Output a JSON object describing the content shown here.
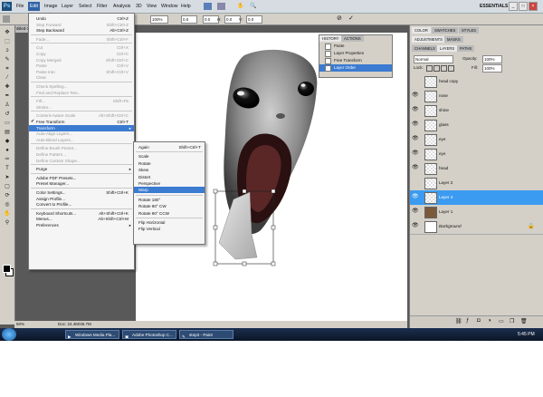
{
  "menubar": {
    "items": [
      "File",
      "Edit",
      "Image",
      "Layer",
      "Select",
      "Filter",
      "Analysis",
      "3D",
      "View",
      "Window",
      "Help"
    ],
    "active": "Edit",
    "workspace": "ESSENTIALS"
  },
  "options": {
    "zoom": "100%",
    "w": "0.0",
    "h": "0.0",
    "hlabel": "H:",
    "vlabel": "V:",
    "h_deg": "0.0"
  },
  "document": {
    "tab": "Untitled-1",
    "zoom": "50%",
    "info": "Doc: 24.4M/46.7M"
  },
  "edit_menu": [
    {
      "label": "Undo",
      "shortcut": "Ctrl+Z",
      "dis": false
    },
    {
      "label": "Step Forward",
      "shortcut": "Shift+Ctrl+Z",
      "dis": true
    },
    {
      "label": "Step Backward",
      "shortcut": "Alt+Ctrl+Z",
      "dis": false
    },
    {
      "sep": true
    },
    {
      "label": "Fade...",
      "shortcut": "Shift+Ctrl+F",
      "dis": true
    },
    {
      "sep": true
    },
    {
      "label": "Cut",
      "shortcut": "Ctrl+X",
      "dis": true
    },
    {
      "label": "Copy",
      "shortcut": "Ctrl+C",
      "dis": true
    },
    {
      "label": "Copy Merged",
      "shortcut": "Shift+Ctrl+C",
      "dis": true
    },
    {
      "label": "Paste",
      "shortcut": "Ctrl+V",
      "dis": true
    },
    {
      "label": "Paste Into",
      "shortcut": "Shift+Ctrl+V",
      "dis": true
    },
    {
      "label": "Clear",
      "shortcut": "",
      "dis": true
    },
    {
      "sep": true
    },
    {
      "label": "Check Spelling...",
      "shortcut": "",
      "dis": true
    },
    {
      "label": "Find and Replace Text...",
      "shortcut": "",
      "dis": true
    },
    {
      "sep": true
    },
    {
      "label": "Fill...",
      "shortcut": "Shift+F5",
      "dis": true
    },
    {
      "label": "Stroke...",
      "shortcut": "",
      "dis": true
    },
    {
      "sep": true
    },
    {
      "label": "Content-Aware Scale",
      "shortcut": "Alt+Shift+Ctrl+C",
      "dis": true
    },
    {
      "label": "Free Transform",
      "shortcut": "Ctrl+T",
      "dis": false,
      "check": true
    },
    {
      "label": "Transform",
      "shortcut": "",
      "dis": false,
      "hl": true,
      "sub": true
    },
    {
      "label": "Auto-Align Layers...",
      "shortcut": "",
      "dis": true
    },
    {
      "label": "Auto-Blend Layers...",
      "shortcut": "",
      "dis": true
    },
    {
      "sep": true
    },
    {
      "label": "Define Brush Preset...",
      "shortcut": "",
      "dis": true
    },
    {
      "label": "Define Pattern...",
      "shortcut": "",
      "dis": true
    },
    {
      "label": "Define Custom Shape...",
      "shortcut": "",
      "dis": true
    },
    {
      "sep": true
    },
    {
      "label": "Purge",
      "shortcut": "",
      "dis": false,
      "sub": true
    },
    {
      "sep": true
    },
    {
      "label": "Adobe PDF Presets...",
      "shortcut": "",
      "dis": false
    },
    {
      "label": "Preset Manager...",
      "shortcut": "",
      "dis": false
    },
    {
      "sep": true
    },
    {
      "label": "Color Settings...",
      "shortcut": "Shift+Ctrl+K",
      "dis": false
    },
    {
      "label": "Assign Profile...",
      "shortcut": "",
      "dis": false
    },
    {
      "label": "Convert to Profile...",
      "shortcut": "",
      "dis": false
    },
    {
      "sep": true
    },
    {
      "label": "Keyboard Shortcuts...",
      "shortcut": "Alt+Shift+Ctrl+K",
      "dis": false
    },
    {
      "label": "Menus...",
      "shortcut": "Alt+Shift+Ctrl+M",
      "dis": false
    },
    {
      "label": "Preferences",
      "shortcut": "",
      "dis": false,
      "sub": true
    }
  ],
  "transform_menu": [
    {
      "label": "Again",
      "shortcut": "Shift+Ctrl+T"
    },
    {
      "sep": true
    },
    {
      "label": "Scale",
      "shortcut": ""
    },
    {
      "label": "Rotate",
      "shortcut": ""
    },
    {
      "label": "Skew",
      "shortcut": ""
    },
    {
      "label": "Distort",
      "shortcut": ""
    },
    {
      "label": "Perspective",
      "shortcut": ""
    },
    {
      "label": "Warp",
      "shortcut": "",
      "hl": true
    },
    {
      "sep": true
    },
    {
      "label": "Rotate 180°",
      "shortcut": ""
    },
    {
      "label": "Rotate 90° CW",
      "shortcut": ""
    },
    {
      "label": "Rotate 90° CCW",
      "shortcut": ""
    },
    {
      "sep": true
    },
    {
      "label": "Flip Horizontal",
      "shortcut": ""
    },
    {
      "label": "Flip Vertical",
      "shortcut": ""
    }
  ],
  "history": {
    "tabs": [
      "HISTORY",
      "ACTIONS"
    ],
    "rows": [
      {
        "label": "Paste",
        "hl": false
      },
      {
        "label": "Layer Properties",
        "hl": false
      },
      {
        "label": "Free Transform",
        "hl": false
      },
      {
        "label": "Layer Order",
        "hl": true
      }
    ]
  },
  "right_panel": {
    "top_tabs": [
      "COLOR",
      "SWATCHES",
      "STYLES"
    ],
    "mid_tabs": [
      "ADJUSTMENTS",
      "MASKS"
    ],
    "layer_tabs": [
      "CHANNELS",
      "LAYERS",
      "PATHS"
    ],
    "blend_mode": "Normal",
    "opacity_label": "Opacity:",
    "opacity": "100%",
    "lock_label": "Lock:",
    "fill_label": "Fill:",
    "fill": "100%",
    "layers": [
      {
        "name": "head copy",
        "hl": false,
        "eye": false
      },
      {
        "name": "nose",
        "hl": false,
        "eye": true
      },
      {
        "name": "shine",
        "hl": false,
        "eye": true
      },
      {
        "name": "glass",
        "hl": false,
        "eye": true
      },
      {
        "name": "eye",
        "hl": false,
        "eye": true
      },
      {
        "name": "eye",
        "hl": false,
        "eye": true
      },
      {
        "name": "head",
        "hl": false,
        "eye": true
      },
      {
        "name": "Layer 2",
        "hl": false,
        "eye": false
      },
      {
        "name": "Layer 4",
        "hl": true,
        "eye": true
      },
      {
        "name": "Layer 1",
        "hl": false,
        "eye": true
      },
      {
        "name": "Background",
        "hl": false,
        "eye": true
      }
    ]
  },
  "taskbar": {
    "tasks": [
      "Windows Media Pla...",
      "Adobe Photoshop C...",
      "step3 - Paint"
    ],
    "clock": "5:45 PM"
  },
  "colors": {
    "highlight": "#3b7bd1",
    "layer_highlight": "#3b9bf0",
    "app_bg": "#595959"
  }
}
